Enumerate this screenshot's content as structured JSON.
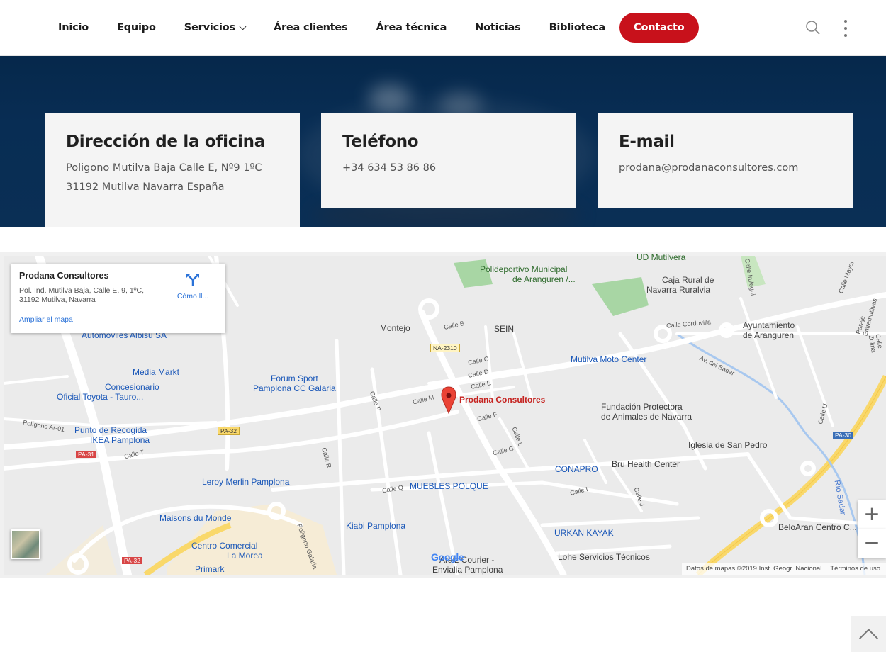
{
  "nav": {
    "items": [
      {
        "label": "Inicio"
      },
      {
        "label": "Equipo"
      },
      {
        "label": "Servicios",
        "has_dropdown": true
      },
      {
        "label": "Área clientes"
      },
      {
        "label": "Área técnica"
      },
      {
        "label": "Noticias"
      },
      {
        "label": "Biblioteca"
      }
    ],
    "cta_label": "Contacto",
    "cta_color": "#c8111b",
    "icons": [
      "search-icon",
      "more-vertical-icon"
    ]
  },
  "contact_cards": [
    {
      "title": "Dirección de la oficina",
      "lines": [
        "Poligono Mutilva Baja Calle E, Nº9 1ºC",
        "31192 Mutilva Navarra España"
      ]
    },
    {
      "title": "Teléfono",
      "lines": [
        "+34 634 53 86 86"
      ]
    },
    {
      "title": "E-mail",
      "lines": [
        "prodana@prodanaconsultores.com"
      ]
    }
  ],
  "map": {
    "info_window": {
      "title": "Prodana Consultores",
      "address_line1": "Pol. Ind. Mutilva Baja, Calle E, 9, 1ºC,",
      "address_line2": "31192 Mutilva, Navarra",
      "enlarge_link": "Ampliar el mapa",
      "directions_label": "Cómo ll..."
    },
    "marker_label": "Prodana Consultores",
    "pois": [
      "Polideportivo Municipal",
      "de Aranguren /...",
      "UD Mutilvera",
      "Caja Rural de",
      "Navarra Ruralvia",
      "Ayuntamiento",
      "de Aranguren",
      "Montejo",
      "SEIN",
      "Mutilva Moto Center",
      "Automóviles Albisu SA",
      "Media Markt",
      "Concesionario",
      "Oficial Toyota -  Tauro...",
      "Forum Sport",
      "Pamplona CC Galaria",
      "Fundación Protectora",
      "de Animales de Navarra",
      "Punto de Recogida",
      "IKEA Pamplona",
      "Iglesia de San Pedro",
      "Bru Health Center",
      "CONAPRO",
      "Leroy Merlin Pamplona",
      "MUEBLES POLQUE",
      "Maisons du Monde",
      "Kiabi Pamplona",
      "URKAN KAYAK",
      "Centro Comercial",
      "La Morea",
      "Primark",
      "Lohe Servicios Técnicos",
      "Araiz Courier -",
      "Envialia Pamplona",
      "BeloAran Centro C..."
    ],
    "streets": [
      "Calle B",
      "Calle C",
      "Calle D",
      "Calle E",
      "Calle M",
      "Calle P",
      "Calle F",
      "Calle L",
      "Calle G",
      "Calle Q",
      "Calle I",
      "Calle J",
      "Calle R",
      "Calle T",
      "Calle U",
      "Calle Cordovilla",
      "Av. del Sadar",
      "Calle Iruleguí",
      "Calle Mayor",
      "Paraje Entremutilvas",
      "Calle Zolina",
      "Polígono Ar-01",
      "Polígono Galaria",
      "Río Sadar"
    ],
    "road_shields": [
      "NA-2310",
      "PA-32",
      "PA-31",
      "PA-30",
      "PA-32"
    ],
    "footer_data": "Datos de mapas ©2019 Inst. Geogr. Nacional",
    "footer_terms": "Términos de uso",
    "google_logo": "Google",
    "zoom_in": "+",
    "zoom_out": "−"
  }
}
